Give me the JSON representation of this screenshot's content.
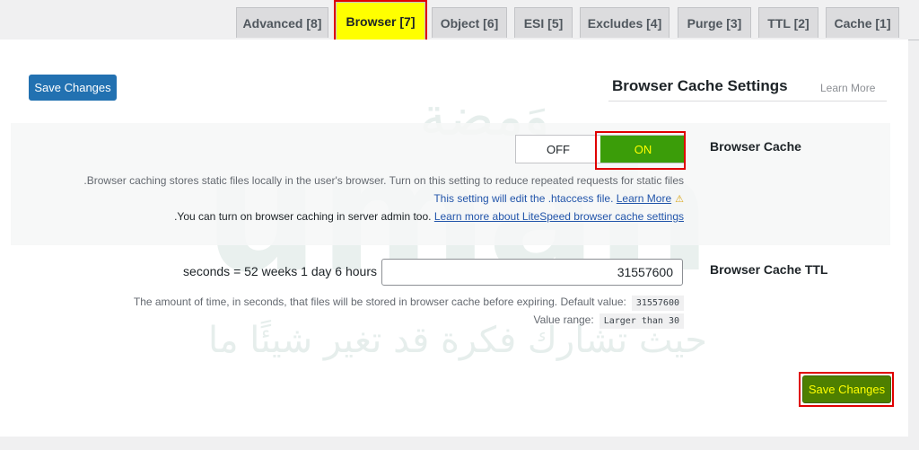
{
  "tabs": [
    {
      "label": "Advanced [8]"
    },
    {
      "label": "Browser [7]"
    },
    {
      "label": "Object [6]"
    },
    {
      "label": "ESI [5]"
    },
    {
      "label": "Excludes [4]"
    },
    {
      "label": "Purge [3]"
    },
    {
      "label": "TTL [2]"
    },
    {
      "label": "Cache [1]"
    }
  ],
  "active_tab": "Browser [7]",
  "top": {
    "save_label": "Save Changes",
    "section_title": "Browser Cache Settings",
    "learn_more": "Learn More"
  },
  "browser_cache": {
    "label": "Browser Cache",
    "off_label": "OFF",
    "on_label": "ON",
    "state": "ON",
    "desc1": ".Browser caching stores static files locally in the user's browser. Turn on this setting to reduce repeated requests for static files",
    "desc2_text": "This setting will edit the .htaccess file.",
    "desc2_link": "Learn More",
    "desc3_text": ".You can turn on browser caching in server admin too.",
    "desc3_link": "Learn more about LiteSpeed browser cache settings"
  },
  "ttl": {
    "label": "Browser Cache TTL",
    "readable": "seconds = 52 weeks 1 day 6 hours",
    "value": "31557600",
    "help_text": "The amount of time, in seconds, that files will be stored in browser cache before expiring. Default value:",
    "default_value": "31557600",
    "range_label": "Value range:",
    "range_value": "Larger than 30"
  },
  "bottom": {
    "save_label": "Save Changes"
  },
  "watermark": {
    "logo_text": "وَمضة",
    "big_text": "umah",
    "tagline": "حيث تشارك فكرة قد تغير شيئًا ما"
  },
  "colors": {
    "active_tab": "#ffff00",
    "highlight": "#e00000",
    "on_green": "#3b9d09",
    "save_blue": "#2271b1",
    "save_green": "#4e7f00"
  }
}
